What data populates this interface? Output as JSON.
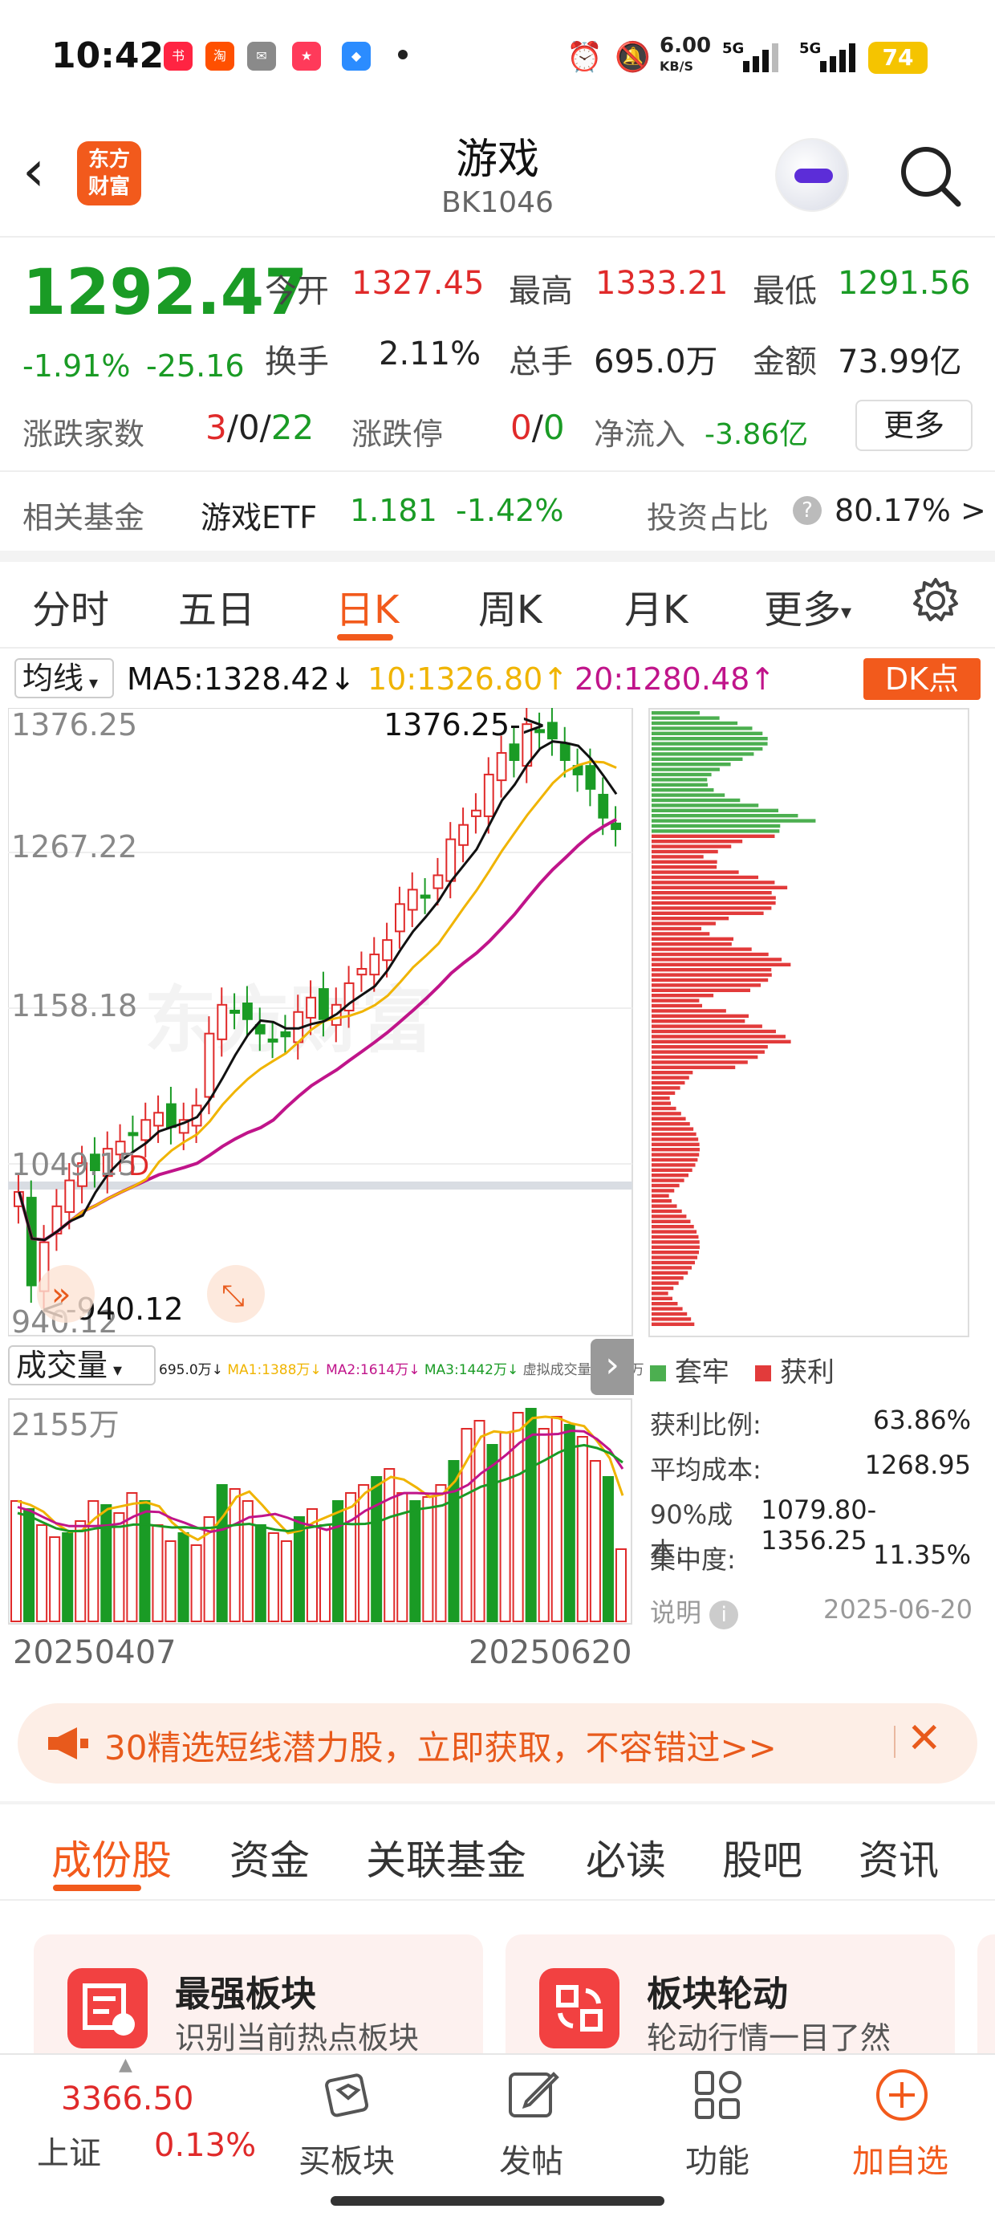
{
  "status_bar": {
    "time": "10:42",
    "apps": [
      "小红书",
      "淘",
      "💬",
      "618",
      "🎨"
    ],
    "net_speed": "6.00",
    "net_unit": "KB/S",
    "battery": "74"
  },
  "header": {
    "logo_text": "东方\n财富",
    "title": "游戏",
    "code": "BK1046"
  },
  "quote": {
    "price": "1292.47",
    "change_pct": "-1.91%",
    "change": "-25.16",
    "open_label": "今开",
    "open": "1327.45",
    "high_label": "最高",
    "high": "1333.21",
    "low_label": "最低",
    "low": "1291.56",
    "turnover_label": "换手",
    "turnover": "2.11%",
    "volume_label": "总手",
    "volume": "695.0万",
    "amount_label": "金额",
    "amount": "73.99亿",
    "updown_label": "涨跌家数",
    "up": "3",
    "flat": "0",
    "down": "22",
    "limit_label": "涨跌停",
    "limit_up": "0",
    "limit_down": "0",
    "netflow_label": "净流入",
    "netflow": "-3.86亿",
    "more_label": "更多"
  },
  "fund": {
    "label": "相关基金",
    "name": "游戏ETF",
    "price": "1.181",
    "pct": "-1.42%",
    "ratio_label": "投资占比",
    "ratio": "80.17% >"
  },
  "period_tabs": [
    "分时",
    "五日",
    "日K",
    "周K",
    "月K",
    "更多"
  ],
  "active_period": "日K",
  "ma": {
    "selector": "均线",
    "ma5": "MA5:1328.42↓",
    "ma10": "10:1326.80↑",
    "ma20": "20:1280.48↑",
    "dk": "DK点"
  },
  "chart_labels": {
    "y_top": "1376.25",
    "y_2": "1267.22",
    "y_3": "1158.18",
    "y_4": "1049.15",
    "y_bottom": "940.12",
    "max_marker": "1376.25->",
    "min_marker": "<-940.12",
    "d_marker": "D",
    "watermark": "东方财富"
  },
  "volume": {
    "selector": "成交量",
    "legend_vol": "695.0万↓",
    "legend_ma1": "MA1:1388万↓",
    "legend_ma2": "MA2:1614万↓",
    "legend_ma3": "MA3:1442万↓",
    "legend_virtual": "虚拟成交量:1515万",
    "y_label": "2155万",
    "date_start": "20250407",
    "date_end": "20250620"
  },
  "chip": {
    "legend_trapped": "套牢",
    "legend_profit": "获利",
    "rows": [
      {
        "label": "获利比例:",
        "value": "63.86%"
      },
      {
        "label": "平均成本:",
        "value": "1268.95"
      },
      {
        "label": "90%成本:",
        "value": "1079.80-1356.25"
      },
      {
        "label": "集中度:",
        "value": "11.35%"
      }
    ],
    "explain": "说明",
    "date": "2025-06-20"
  },
  "tip": {
    "text": "30精选短线潜力股，立即获取，不容错过>>"
  },
  "bottom_tabs": [
    "成份股",
    "资金",
    "关联基金",
    "必读",
    "股吧",
    "资讯"
  ],
  "cards": [
    {
      "title": "最强板块",
      "subtitle": "识别当前热点板块"
    },
    {
      "title": "板块轮动",
      "subtitle": "轮动行情一目了然"
    }
  ],
  "nav": {
    "index_value": "3366.50",
    "index_name": "上证",
    "index_pct": "0.13%",
    "items": [
      "买板块",
      "发帖",
      "功能",
      "加自选"
    ]
  },
  "colors": {
    "up": "#e02a2a",
    "down": "#1a9b25",
    "accent": "#f25a1c",
    "ma5": "#111111",
    "ma10": "#f0b400",
    "ma20": "#c0148a"
  },
  "chart_data": {
    "type": "candlestick",
    "ylim": [
      940.12,
      1376.25
    ],
    "series": [
      {
        "name": "MA5",
        "values": [
          1328.42
        ]
      },
      {
        "name": "MA10",
        "values": [
          1326.8
        ]
      },
      {
        "name": "MA20",
        "values": [
          1280.48
        ]
      }
    ]
  }
}
